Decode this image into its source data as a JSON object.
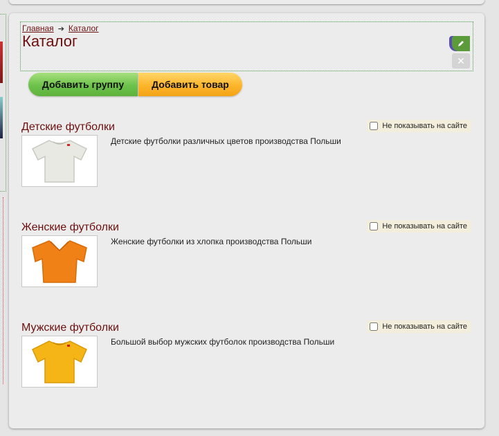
{
  "breadcrumb": {
    "home": "Главная",
    "separator": "➔",
    "current": "Каталог"
  },
  "page": {
    "title": "Каталог"
  },
  "actions": {
    "add_group": "Добавить группу",
    "add_product": "Добавить товар"
  },
  "colors": {
    "accent_title": "#6b0f0f",
    "green": "#6cc24a",
    "orange": "#fdb52b",
    "edit_green": "#5b9b3a",
    "edit_purple": "#5a4fb0"
  },
  "items": [
    {
      "title": "Детские футболки",
      "description": "Детские футболки различных цветов производства Польши",
      "hide_label": "Не показывать на сайте",
      "hidden": false,
      "shirt_color": "#e9e9e4"
    },
    {
      "title": "Женские футболки",
      "description": "Женские футболки из хлопка производства Польши",
      "hide_label": "Не показывать на сайте",
      "hidden": false,
      "shirt_color": "#f08117"
    },
    {
      "title": "Мужские футболки",
      "description": "Большой выбор мужских футболок производства Польши",
      "hide_label": "Не показывать на сайте",
      "hidden": false,
      "shirt_color": "#f5b516"
    }
  ]
}
